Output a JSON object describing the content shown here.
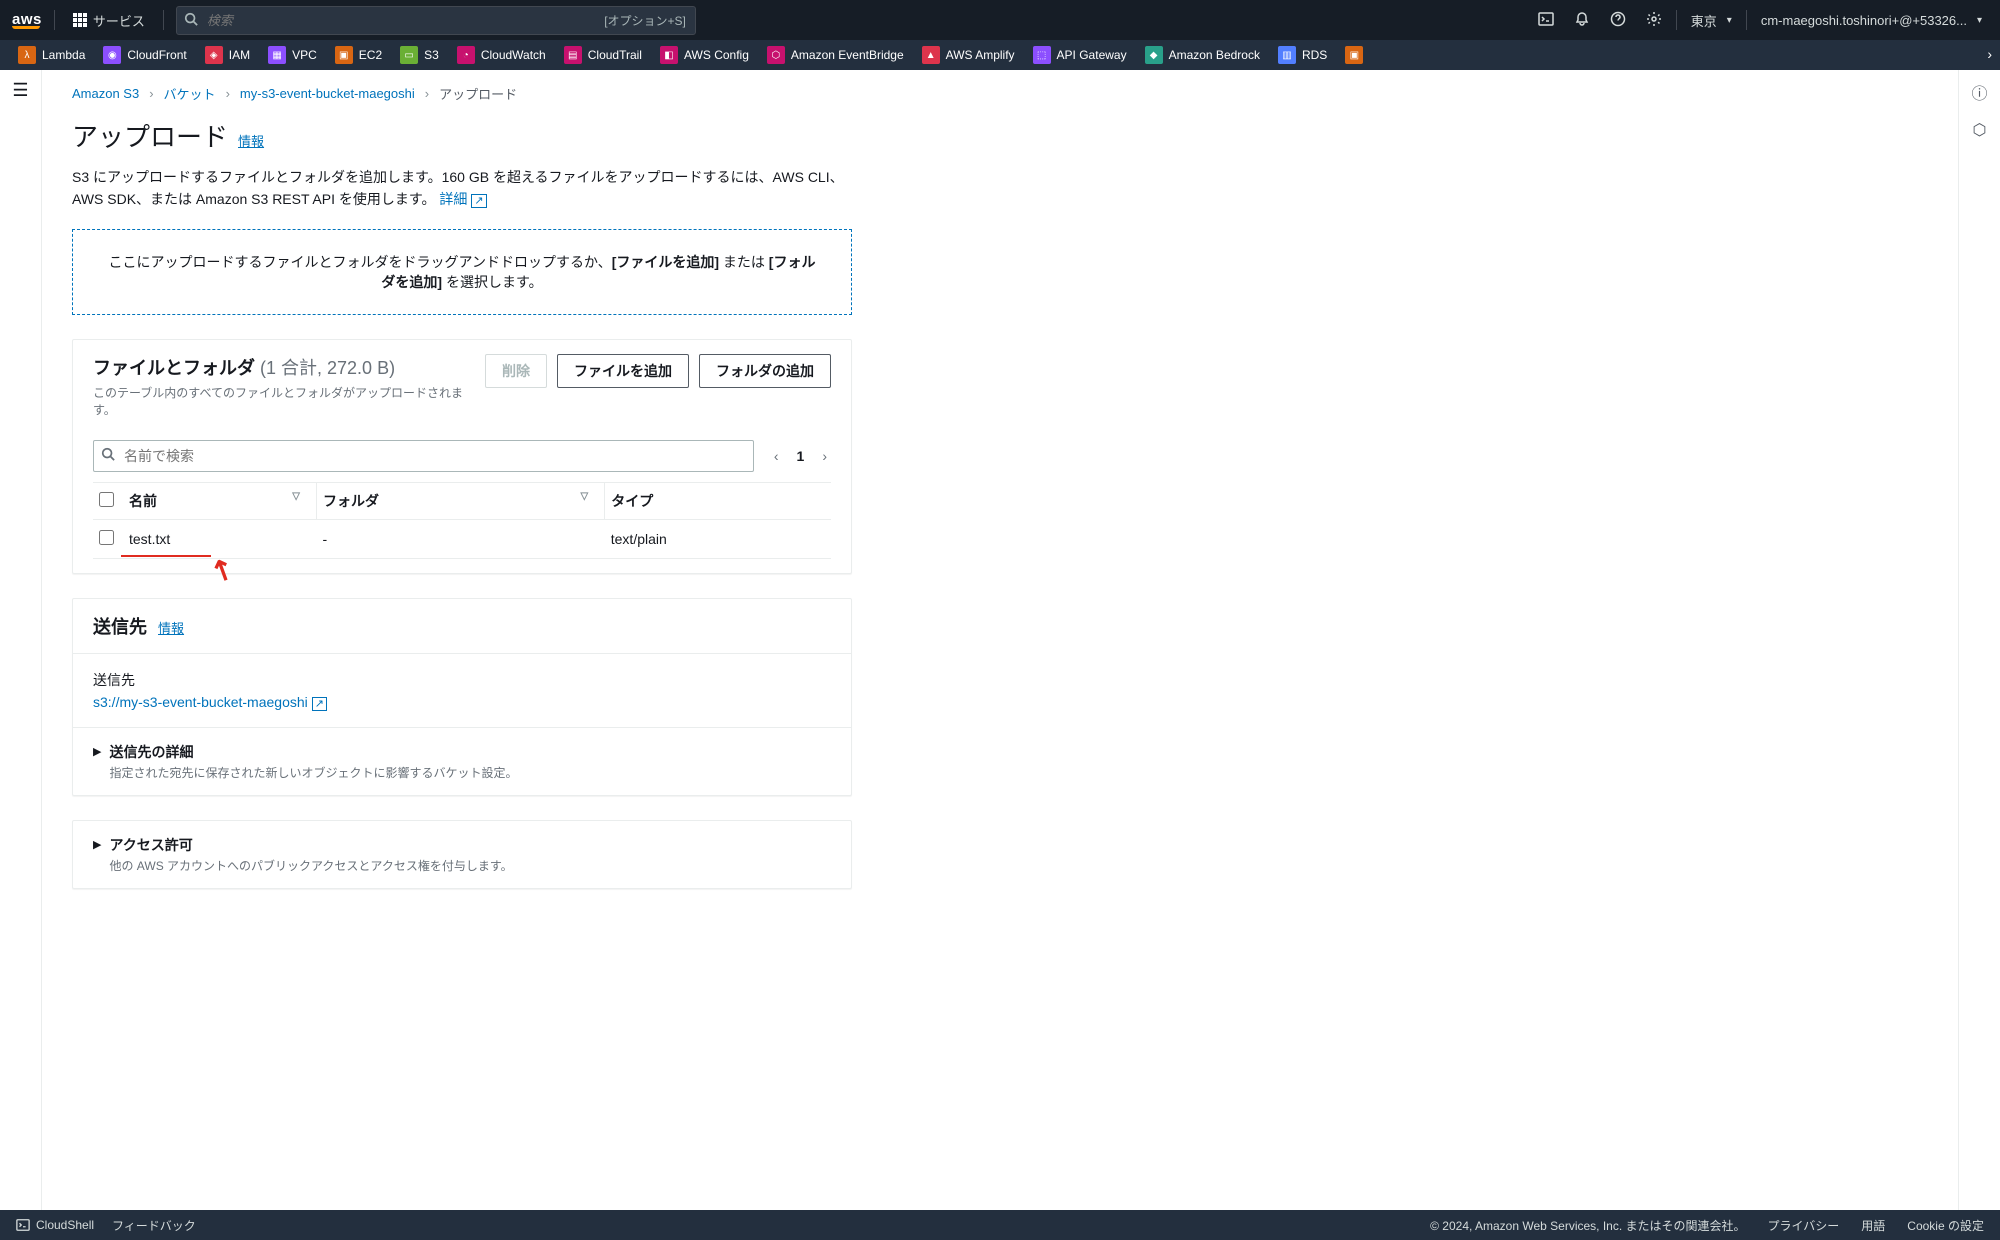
{
  "nav": {
    "logo": "aws",
    "services_label": "サービス",
    "search_placeholder": "検索",
    "search_hint": "[オプション+S]",
    "region": "東京",
    "account": "cm-maegoshi.toshinori+@+53326..."
  },
  "favorites": [
    {
      "name": "Lambda",
      "color": "#d86613"
    },
    {
      "name": "CloudFront",
      "color": "#8c4fff"
    },
    {
      "name": "IAM",
      "color": "#dd344c"
    },
    {
      "name": "VPC",
      "color": "#8c4fff"
    },
    {
      "name": "EC2",
      "color": "#d86613"
    },
    {
      "name": "S3",
      "color": "#6aaf35"
    },
    {
      "name": "CloudWatch",
      "color": "#c7116e"
    },
    {
      "name": "CloudTrail",
      "color": "#c7116e"
    },
    {
      "name": "AWS Config",
      "color": "#c7116e"
    },
    {
      "name": "Amazon EventBridge",
      "color": "#c7116e"
    },
    {
      "name": "AWS Amplify",
      "color": "#dd344c"
    },
    {
      "name": "API Gateway",
      "color": "#8c4fff"
    },
    {
      "name": "Amazon Bedrock",
      "color": "#29a08a"
    },
    {
      "name": "RDS",
      "color": "#527fff"
    }
  ],
  "breadcrumb": {
    "s3": "Amazon S3",
    "buckets": "バケット",
    "bucket_name": "my-s3-event-bucket-maegoshi",
    "current": "アップロード"
  },
  "page": {
    "title": "アップロード",
    "info": "情報",
    "desc_1": "S3 にアップロードするファイルとフォルダを追加します。160 GB を超えるファイルをアップロードするには、AWS CLI、AWS SDK、または Amazon S3 REST API を使用します。",
    "detail_link": "詳細"
  },
  "dropzone": {
    "pre": "ここにアップロードするファイルとフォルダをドラッグアンドドロップするか、",
    "add_files": "[ファイルを追加]",
    "or": " または ",
    "add_folder": "[フォルダを追加]",
    "post": " を選択します。"
  },
  "files_card": {
    "title": "ファイルとフォルダ",
    "count": "(1 合計, 272.0 B)",
    "sub": "このテーブル内のすべてのファイルとフォルダがアップロードされます。",
    "delete_btn": "削除",
    "add_file_btn": "ファイルを追加",
    "add_folder_btn": "フォルダの追加",
    "filter_placeholder": "名前で検索",
    "page": "1",
    "cols": {
      "name": "名前",
      "folder": "フォルダ",
      "type": "タイプ"
    },
    "row": {
      "name": "test.txt",
      "folder": "-",
      "type": "text/plain"
    }
  },
  "dest": {
    "title": "送信先",
    "info": "情報",
    "label": "送信先",
    "value": "s3://my-s3-event-bucket-maegoshi",
    "details_title": "送信先の詳細",
    "details_desc": "指定された宛先に保存された新しいオブジェクトに影響するバケット設定。"
  },
  "perm": {
    "title": "アクセス許可",
    "desc": "他の AWS アカウントへのパブリックアクセスとアクセス権を付与します。"
  },
  "footer": {
    "cloudshell": "CloudShell",
    "feedback": "フィードバック",
    "copyright": "© 2024, Amazon Web Services, Inc. またはその関連会社。",
    "privacy": "プライバシー",
    "terms": "用語",
    "cookies": "Cookie の設定"
  }
}
